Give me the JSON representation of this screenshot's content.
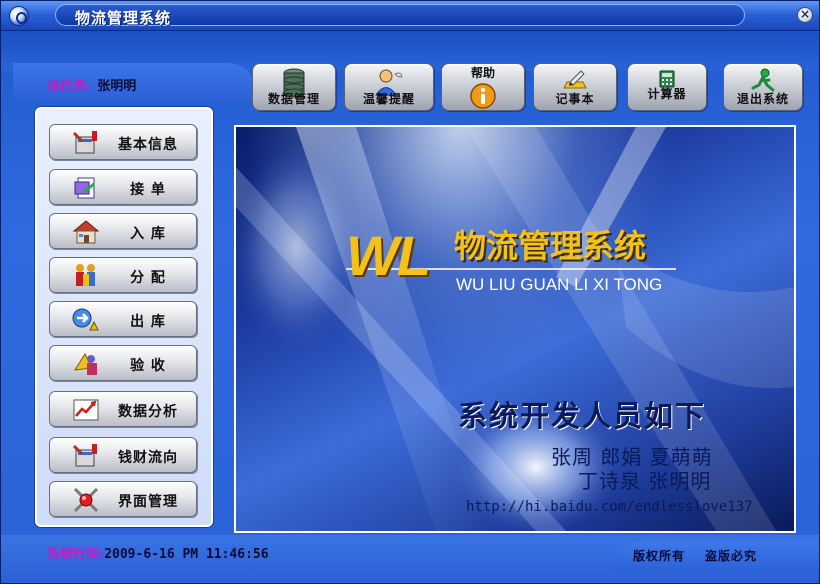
{
  "window": {
    "title": "物流管理系统",
    "close_glyph": "×"
  },
  "operator": {
    "label": "操作员:",
    "name": "张明明"
  },
  "toolbar": {
    "items": [
      {
        "label": "数据管理",
        "icon": "database-icon"
      },
      {
        "label": "温馨提醒",
        "icon": "reminder-person-icon"
      },
      {
        "label": "帮助",
        "icon": "info-icon"
      },
      {
        "label": "记事本",
        "icon": "notepad-icon"
      },
      {
        "label": "计算器",
        "icon": "calculator-icon"
      },
      {
        "label": "退出系统",
        "icon": "exit-icon"
      }
    ]
  },
  "sidebar": {
    "items": [
      {
        "label": "基本信息",
        "icon": "tools-info-icon"
      },
      {
        "label": "接  单",
        "icon": "order-icon"
      },
      {
        "label": "入  库",
        "icon": "warehouse-in-icon"
      },
      {
        "label": "分  配",
        "icon": "distribute-icon"
      },
      {
        "label": "出  库",
        "icon": "warehouse-out-icon"
      },
      {
        "label": "验  收",
        "icon": "inspection-icon"
      },
      {
        "label": "数据分析",
        "icon": "chart-analysis-icon"
      },
      {
        "label": "钱财流向",
        "icon": "money-flow-icon"
      },
      {
        "label": "界面管理",
        "icon": "interface-settings-icon"
      }
    ]
  },
  "banner": {
    "logo": "WL",
    "title": "物流管理系统",
    "pinyin": "WU LIU GUAN LI XI TONG",
    "developers_heading": "系统开发人员如下",
    "developers_line1": "张周 郎娟 夏萌萌",
    "developers_line2": "丁诗泉  张明明",
    "url": "http://hi.baidu.com/endlesslove137"
  },
  "status": {
    "time_label": "系统时间:",
    "time_value": "2009-6-16  PM  11:46:56",
    "copyright": "版权所有",
    "piracy": "盗版必究"
  },
  "colors": {
    "accent_magenta": "#c51bc4",
    "window_blue": "#2a63d6",
    "banner_yellow": "#f2c21a"
  }
}
